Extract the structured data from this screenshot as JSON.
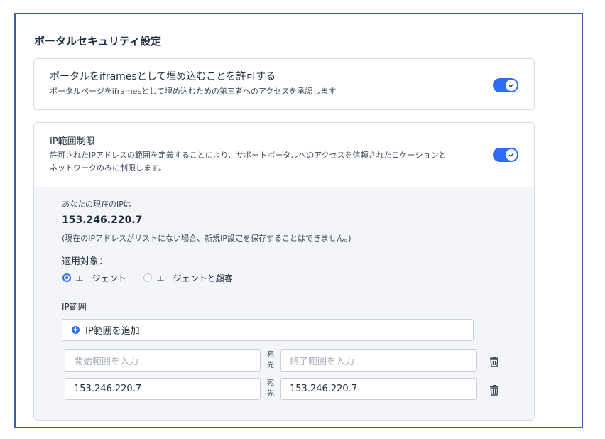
{
  "section": {
    "title": "ポータルセキュリティ設定"
  },
  "iframes": {
    "title": "ポータルをiframesとして埋め込むことを許可する",
    "description": "ポータルページをiframesとして埋め込むための第三者へのアクセスを承認します",
    "enabled": true
  },
  "ip_restriction": {
    "title": "IP範囲制限",
    "description_line1": "許可されたIPアドレスの範囲を定義することにより、サポートポータルへのアクセスを信頼されたロケーションと",
    "description_line2": "ネットワークのみに制限します。",
    "enabled": true,
    "current_ip_label": "あなたの現在のIPは",
    "current_ip": "153.246.220.7",
    "current_ip_note": "(現在のIPアドレスがリストにない場合、新規IP設定を保存することはできません。)",
    "applies_to_label": "適用対象：",
    "applies_to_options": [
      {
        "label": "エージェント",
        "selected": true
      },
      {
        "label": "エージェントと顧客",
        "selected": false
      }
    ],
    "range_label": "IP範囲",
    "add_range_label": "IP範囲を追加",
    "to_label_1": "宛",
    "to_label_2": "先",
    "ranges": [
      {
        "start": "",
        "end": "",
        "start_placeholder": "開始範囲を入力",
        "end_placeholder": "終了範囲を入力"
      },
      {
        "start": "153.246.220.7",
        "end": "153.246.220.7"
      }
    ]
  },
  "colors": {
    "accent": "#2f6cf6",
    "frame_border": "#3b5ea7",
    "panel_bg": "#f3f5f8"
  }
}
